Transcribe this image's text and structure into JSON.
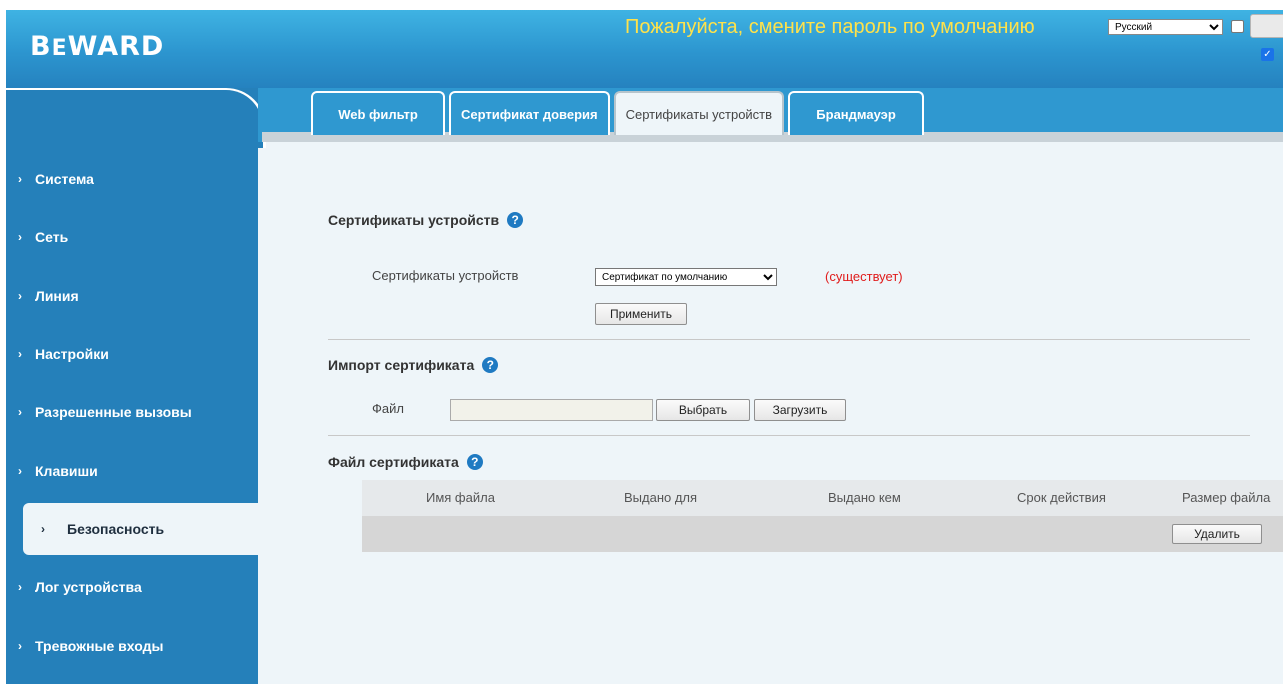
{
  "header": {
    "logo": "BeWARD",
    "banner": "Пожалуйста, смените пароль по умолчанию",
    "language_selected": "Русский"
  },
  "sidebar": {
    "items": [
      {
        "label": "Система"
      },
      {
        "label": "Сеть"
      },
      {
        "label": "Линия"
      },
      {
        "label": "Настройки"
      },
      {
        "label": "Разрешенные вызовы"
      },
      {
        "label": "Клавиши"
      },
      {
        "label": "Безопасность",
        "active": true
      },
      {
        "label": "Лог устройства"
      },
      {
        "label": "Тревожные входы"
      }
    ]
  },
  "tabs": [
    {
      "label": "Web фильтр"
    },
    {
      "label": "Сертификат доверия"
    },
    {
      "label": "Сертификаты устройств",
      "active": true
    },
    {
      "label": "Брандмауэр"
    }
  ],
  "device_certs": {
    "title": "Сертификаты устройств",
    "field_label": "Сертификаты устройств",
    "selected": "Сертификат по умолчанию",
    "status": "(существует)",
    "apply_label": "Применить"
  },
  "import": {
    "title": "Импорт сертификата",
    "file_label": "Файл",
    "browse_label": "Выбрать",
    "upload_label": "Загрузить"
  },
  "cert_file": {
    "title": "Файл сертификата",
    "columns": [
      "Имя файла",
      "Выдано для",
      "Выдано кем",
      "Срок действия",
      "Размер файла"
    ],
    "delete_label": "Удалить"
  },
  "colors": {
    "header": "#2c95cf",
    "sidebar": "#2580ba",
    "banner": "#ffe24a",
    "status": "#e01c1c"
  }
}
